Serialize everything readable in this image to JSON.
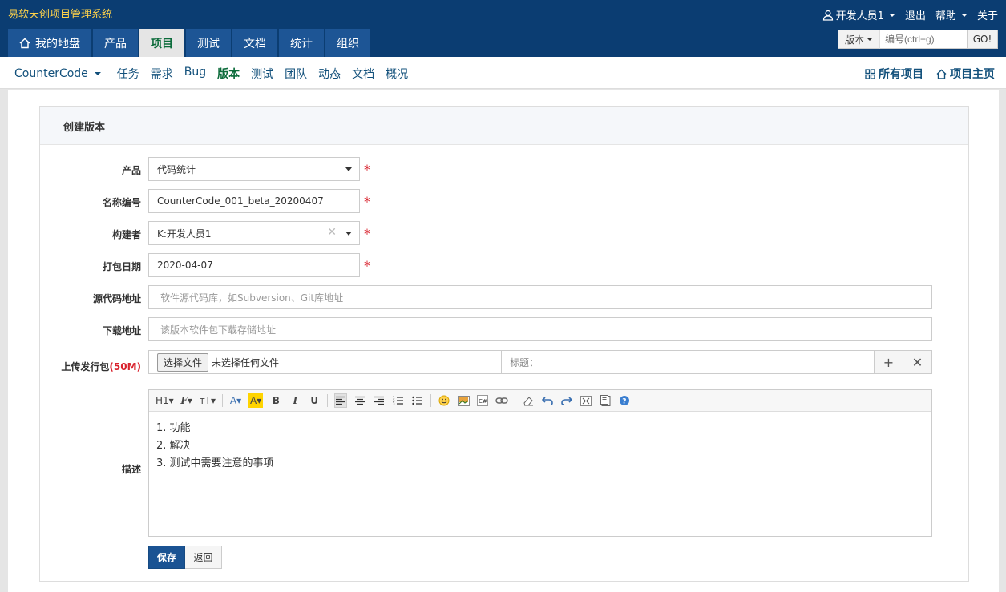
{
  "app": {
    "title": "易软天创项目管理系统"
  },
  "topbar": {
    "user": "开发人员1",
    "logout": "退出",
    "help": "帮助",
    "about": "关于"
  },
  "mainnav": {
    "tabs": [
      {
        "label": "我的地盘",
        "icon": "home-icon"
      },
      {
        "label": "产品"
      },
      {
        "label": "项目",
        "active": true
      },
      {
        "label": "测试"
      },
      {
        "label": "文档"
      },
      {
        "label": "统计"
      },
      {
        "label": "组织"
      }
    ]
  },
  "search": {
    "type": "版本",
    "placeholder": "编号(ctrl+g)",
    "go": "GO!"
  },
  "subnav": {
    "project": "CounterCode",
    "items": [
      "任务",
      "需求",
      "Bug",
      "版本",
      "测试",
      "团队",
      "动态",
      "文档",
      "概况"
    ],
    "active": "版本",
    "all_projects": "所有项目",
    "project_home": "项目主页"
  },
  "form": {
    "title": "创建版本",
    "product": {
      "label": "产品",
      "value": "代码统计"
    },
    "name": {
      "label": "名称编号",
      "value": "CounterCode_001_beta_20200407"
    },
    "builder": {
      "label": "构建者",
      "value": "K:开发人员1"
    },
    "date": {
      "label": "打包日期",
      "value": "2020-04-07"
    },
    "scm": {
      "label": "源代码地址",
      "placeholder": "软件源代码库，如Subversion、Git库地址"
    },
    "download": {
      "label": "下载地址",
      "placeholder": "该版本软件包下载存储地址"
    },
    "upload": {
      "label": "上传发行包",
      "limit": "(50M)",
      "choose": "选择文件",
      "no_file": "未选择任何文件",
      "title_label": "标题："
    },
    "desc": {
      "label": "描述",
      "lines": [
        "1. 功能",
        "2. 解决",
        "3. 测试中需要注意的事项"
      ]
    },
    "required_mark": "*",
    "save": "保存",
    "back": "返回"
  },
  "colors": {
    "header_bg": "#0b3d72",
    "tab_bg": "#1d5595",
    "active_green": "#0b6b3a",
    "required_red": "#d9232e",
    "save_btn": "#1a5393"
  }
}
